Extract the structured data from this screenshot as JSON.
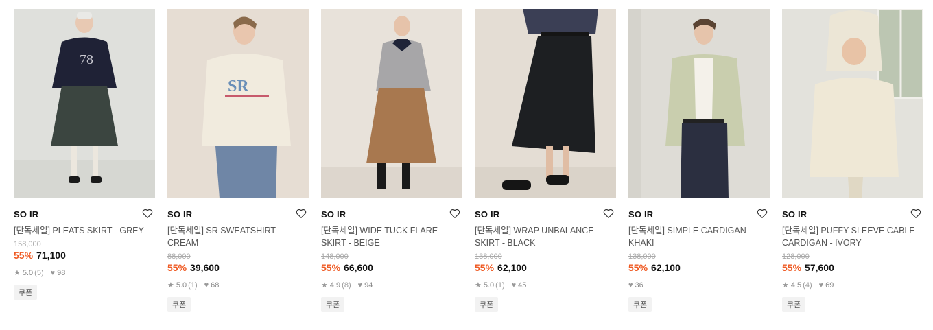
{
  "products": [
    {
      "brand": "SO IR",
      "name": "[단독세일] PLEATS SKIRT - GREY",
      "original_price": "158,000",
      "discount": "55%",
      "price": "71,100",
      "rating": "5.0",
      "review_count": "(5)",
      "likes": "98",
      "coupon": "쿠폰"
    },
    {
      "brand": "SO IR",
      "name": "[단독세일] SR SWEATSHIRT - CREAM",
      "original_price": "88,000",
      "discount": "55%",
      "price": "39,600",
      "rating": "5.0",
      "review_count": "(1)",
      "likes": "68",
      "coupon": "쿠폰"
    },
    {
      "brand": "SO IR",
      "name": "[단독세일] WIDE TUCK FLARE SKIRT - BEIGE",
      "original_price": "148,000",
      "discount": "55%",
      "price": "66,600",
      "rating": "4.9",
      "review_count": "(8)",
      "likes": "94",
      "coupon": "쿠폰"
    },
    {
      "brand": "SO IR",
      "name": "[단독세일] WRAP UNBALANCE SKIRT - BLACK",
      "original_price": "138,000",
      "discount": "55%",
      "price": "62,100",
      "rating": "5.0",
      "review_count": "(1)",
      "likes": "45",
      "coupon": "쿠폰"
    },
    {
      "brand": "SO IR",
      "name": "[단독세일] SIMPLE CARDIGAN - KHAKI",
      "original_price": "138,000",
      "discount": "55%",
      "price": "62,100",
      "rating": null,
      "review_count": null,
      "likes": "36",
      "coupon": "쿠폰"
    },
    {
      "brand": "SO IR",
      "name": "[단독세일] PUFFY SLEEVE CABLE CARDIGAN - IVORY",
      "original_price": "128,000",
      "discount": "55%",
      "price": "57,600",
      "rating": "4.5",
      "review_count": "(4)",
      "likes": "69",
      "coupon": "쿠폰"
    }
  ],
  "icons": {
    "wishlist": "heart-outline-icon",
    "rating": "star-icon",
    "likes": "heart-filled-icon"
  },
  "colors": {
    "discount": "#ef5a23",
    "price": "#111111",
    "muted": "#999999"
  }
}
